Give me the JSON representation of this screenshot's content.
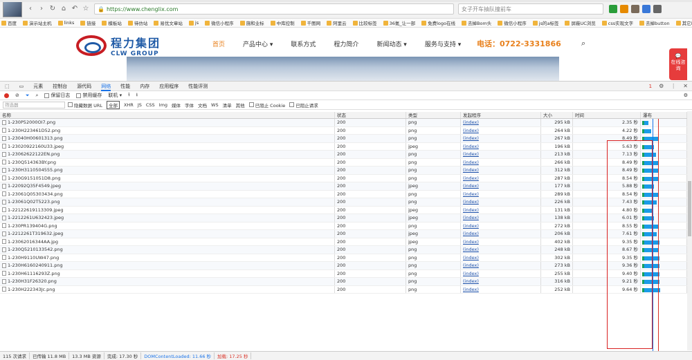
{
  "browser": {
    "url": "https://www.chenglix.com",
    "search_placeholder": "女子开车抽队撞前车"
  },
  "bookmarks": [
    "百度",
    "演示站主机",
    "links",
    "链接",
    "模板站",
    "待仿站",
    "易优文章站",
    "js",
    "微信小程序",
    "施和业标",
    "中库控制",
    "千图网",
    "阿里云",
    "比较标签",
    "36氪_让一部",
    "免费logo在线",
    "去掉Bom头",
    "微信小程序",
    "js的a标签",
    "屏蔽UC浏览",
    "css实现文字",
    "去掉button",
    "其它收藏"
  ],
  "site": {
    "logo_cn": "程力集团",
    "logo_en": "CLW GROUP",
    "nav": [
      "首页",
      "产品中心",
      "联系方式",
      "程力简介",
      "新闻动态",
      "服务与支持"
    ],
    "phone": "电话：0722-3331866",
    "online_label": "在线咨询"
  },
  "devtools": {
    "tabs": [
      "元素",
      "控制台",
      "源代码",
      "网络",
      "性能",
      "内存",
      "应用程序",
      "性能评测"
    ],
    "active_tab": "网络",
    "error_count": "1",
    "toolbar": {
      "preserve_log": "保留日志",
      "disable_cache": "禁用缓存",
      "throttle": "联机"
    },
    "filter": {
      "placeholder": "筛选器",
      "hide_data_url": "隐藏数据 URL",
      "types": [
        "全部",
        "XHR",
        "JS",
        "CSS",
        "Img",
        "媒体",
        "字体",
        "文档",
        "WS",
        "清单",
        "其他"
      ],
      "blocked_cookies": "已阻止 Cookie",
      "blocked_requests": "已阻止请求"
    },
    "columns": {
      "name": "名称",
      "status": "状态",
      "type": "类型",
      "initiator": "发起程序",
      "size": "大小",
      "time": "时间",
      "waterfall": "瀑布"
    },
    "rows": [
      {
        "name": "1-230P52000OI7.png",
        "status": "200",
        "type": "png",
        "initiator": "(index)",
        "size": "295 kB",
        "time": "2.35 秒",
        "wait": 0.05,
        "dl": 0.08
      },
      {
        "name": "1-230H223461D52.png",
        "status": "200",
        "type": "png",
        "initiator": "(index)",
        "size": "264 kB",
        "time": "4.22 秒",
        "wait": 0.05,
        "dl": 0.15
      },
      {
        "name": "1-23040H00601313.png",
        "status": "200",
        "type": "png",
        "initiator": "(index)",
        "size": "267 kB",
        "time": "8.49 秒",
        "wait": 0.05,
        "dl": 0.3
      },
      {
        "name": "1-23020922160U33.jpeg",
        "status": "200",
        "type": "jpeg",
        "initiator": "(index)",
        "size": "196 kB",
        "time": "5.63 秒",
        "wait": 0.05,
        "dl": 0.2
      },
      {
        "name": "1-23062622122EN.png",
        "status": "200",
        "type": "png",
        "initiator": "(index)",
        "size": "213 kB",
        "time": "7.13 秒",
        "wait": 0.05,
        "dl": 0.25
      },
      {
        "name": "1-230Q514363BY.png",
        "status": "200",
        "type": "png",
        "initiator": "(index)",
        "size": "266 kB",
        "time": "8.49 秒",
        "wait": 0.05,
        "dl": 0.3
      },
      {
        "name": "1-230H3110504555.png",
        "status": "200",
        "type": "png",
        "initiator": "(index)",
        "size": "312 kB",
        "time": "8.49 秒",
        "wait": 0.05,
        "dl": 0.3
      },
      {
        "name": "1-230G9151051D8.png",
        "status": "200",
        "type": "png",
        "initiator": "(index)",
        "size": "287 kB",
        "time": "8.54 秒",
        "wait": 0.05,
        "dl": 0.3
      },
      {
        "name": "1-22092Q35F4549.jpeg",
        "status": "200",
        "type": "jpeg",
        "initiator": "(index)",
        "size": "177 kB",
        "time": "5.88 秒",
        "wait": 0.05,
        "dl": 0.2
      },
      {
        "name": "1-23061Q05303434.png",
        "status": "200",
        "type": "png",
        "initiator": "(index)",
        "size": "289 kB",
        "time": "8.54 秒",
        "wait": 0.05,
        "dl": 0.3
      },
      {
        "name": "1-23061Q02T5223.png",
        "status": "200",
        "type": "png",
        "initiator": "(index)",
        "size": "226 kB",
        "time": "7.43 秒",
        "wait": 0.05,
        "dl": 0.26
      },
      {
        "name": "1-22122619113309.jpeg",
        "status": "200",
        "type": "jpeg",
        "initiator": "(index)",
        "size": "131 kB",
        "time": "4.80 秒",
        "wait": 0.05,
        "dl": 0.17
      },
      {
        "name": "1-2212261U632423.jpeg",
        "status": "200",
        "type": "jpeg",
        "initiator": "(index)",
        "size": "138 kB",
        "time": "6.01 秒",
        "wait": 0.05,
        "dl": 0.21
      },
      {
        "name": "1-230PR139404G.png",
        "status": "200",
        "type": "png",
        "initiator": "(index)",
        "size": "272 kB",
        "time": "8.55 秒",
        "wait": 0.05,
        "dl": 0.3
      },
      {
        "name": "1-2212261T319632.jpeg",
        "status": "200",
        "type": "jpeg",
        "initiator": "(index)",
        "size": "206 kB",
        "time": "7.61 秒",
        "wait": 0.05,
        "dl": 0.27
      },
      {
        "name": "1-23062016344AA.jpg",
        "status": "200",
        "type": "jpeg",
        "initiator": "(index)",
        "size": "402 kB",
        "time": "9.35 秒",
        "wait": 0.05,
        "dl": 0.33
      },
      {
        "name": "1-230Q5210133542.png",
        "status": "200",
        "type": "png",
        "initiator": "(index)",
        "size": "248 kB",
        "time": "8.67 秒",
        "wait": 0.05,
        "dl": 0.31
      },
      {
        "name": "1-230H9110UW47.png",
        "status": "200",
        "type": "png",
        "initiator": "(index)",
        "size": "302 kB",
        "time": "9.35 秒",
        "wait": 0.05,
        "dl": 0.33
      },
      {
        "name": "1-230H6160240911.png",
        "status": "200",
        "type": "png",
        "initiator": "(index)",
        "size": "273 kB",
        "time": "9.36 秒",
        "wait": 0.05,
        "dl": 0.33
      },
      {
        "name": "1-230H61116293Z.png",
        "status": "200",
        "type": "png",
        "initiator": "(index)",
        "size": "255 kB",
        "time": "9.40 秒",
        "wait": 0.05,
        "dl": 0.33
      },
      {
        "name": "1-230H31F26320.png",
        "status": "200",
        "type": "png",
        "initiator": "(index)",
        "size": "316 kB",
        "time": "9.21 秒",
        "wait": 0.05,
        "dl": 0.32
      },
      {
        "name": "1-230H222343Jc.png",
        "status": "200",
        "type": "png",
        "initiator": "(index)",
        "size": "252 kB",
        "time": "9.64 秒",
        "wait": 0.05,
        "dl": 0.34
      }
    ],
    "status": {
      "requests": "115 次请求",
      "transferred": "已传输 11.8 MB",
      "resources": "13.3 MB 资源",
      "finish": "完成: 17.30 秒",
      "dcl": "DOMContentLoaded: 11.66 秒",
      "load": "加载: 17.25 秒"
    }
  },
  "colors": {
    "accent": "#1a73e8",
    "brand_blue": "#1f5aa6",
    "brand_red": "#c71d23",
    "orange": "#e8801c",
    "highlight": "#d92020"
  }
}
